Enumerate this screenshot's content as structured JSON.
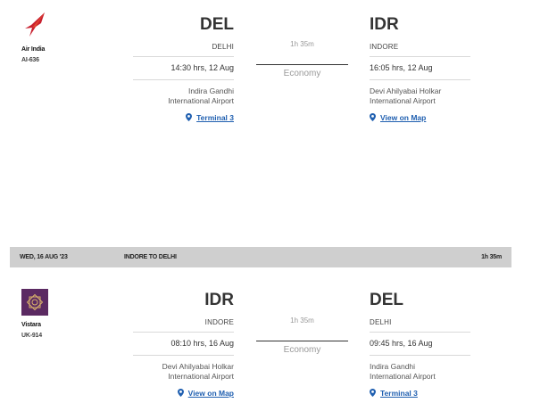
{
  "segments": [
    {
      "airline": "Air India",
      "flight_no": "AI-636",
      "logo_icon": "air-india-logo",
      "departure": {
        "code": "DEL",
        "city": "DELHI",
        "time": "14:30 hrs, 12 Aug",
        "airport_line1": "Indira Gandhi",
        "airport_line2": "International Airport",
        "link": "Terminal 3"
      },
      "duration": "1h 35m",
      "cabin": "Economy",
      "arrival": {
        "code": "IDR",
        "city": "INDORE",
        "time": "16:05 hrs, 12 Aug",
        "airport_line1": "Devi Ahilyabai Holkar",
        "airport_line2": "International Airport",
        "link": "View on Map"
      }
    },
    {
      "airline": "Vistara",
      "flight_no": "UK-914",
      "logo_icon": "vistara-logo",
      "departure": {
        "code": "IDR",
        "city": "INDORE",
        "time": "08:10 hrs, 16 Aug",
        "airport_line1": "Devi Ahilyabai Holkar",
        "airport_line2": "International Airport",
        "link": "View on Map"
      },
      "duration": "1h 35m",
      "cabin": "Economy",
      "arrival": {
        "code": "DEL",
        "city": "DELHI",
        "time": "09:45 hrs, 16 Aug",
        "airport_line1": "Indira Gandhi",
        "airport_line2": "International Airport",
        "link": "Terminal 3"
      }
    }
  ],
  "return_header": {
    "date": "WED, 16 AUG '23",
    "route": "INDORE TO DELHI",
    "duration": "1h 35m"
  },
  "colors": {
    "link": "#1f5fb0",
    "header_bar": "#cfcfcf",
    "air_india_red": "#c8202f",
    "vistara_purple": "#5b2a62"
  }
}
